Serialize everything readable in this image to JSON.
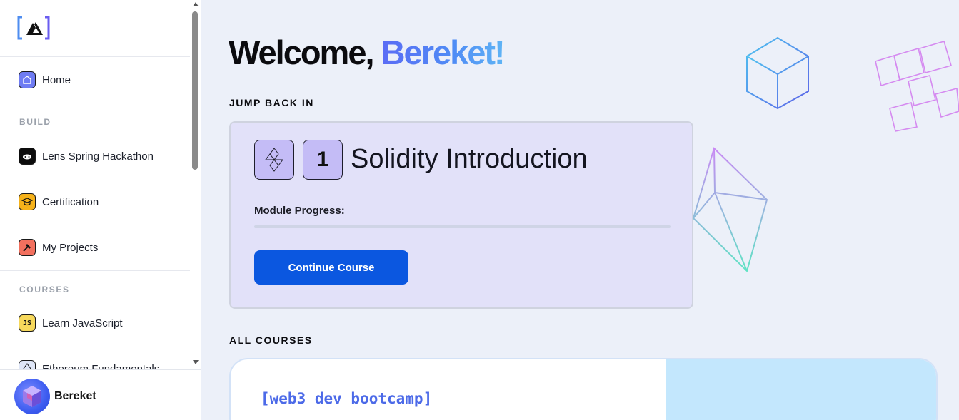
{
  "sidebar": {
    "logo_text": "[A]",
    "home": "Home",
    "section_build": "BUILD",
    "build_items": [
      "Lens Spring Hackathon",
      "Certification",
      "My Projects"
    ],
    "section_courses": "COURSES",
    "course_items": [
      "Learn JavaScript",
      "Ethereum Fundamentals"
    ],
    "user": {
      "name": "Bereket"
    }
  },
  "main": {
    "welcome_prefix": "Welcome, ",
    "welcome_name": "Bereket!",
    "jump_back_heading": "JUMP BACK IN",
    "current_course": {
      "module_number": "1",
      "title": "Solidity Introduction",
      "progress_label": "Module Progress:",
      "progress": 0,
      "button": "Continue Course"
    },
    "all_courses_heading": "ALL COURSES",
    "course_card_title": "[web3 dev bootcamp]"
  },
  "colors": {
    "accent": "#0b57e0",
    "name_gradient_start": "#5b6cf5",
    "card_bg": "#e2e1f9",
    "badge_bg": "#c4bcf6",
    "page_bg": "#ecf0f9"
  },
  "icons": [
    "home-icon",
    "hackathon-icon",
    "certification-icon",
    "projects-icon",
    "javascript-icon",
    "ethereum-icon",
    "solidity-icon"
  ]
}
